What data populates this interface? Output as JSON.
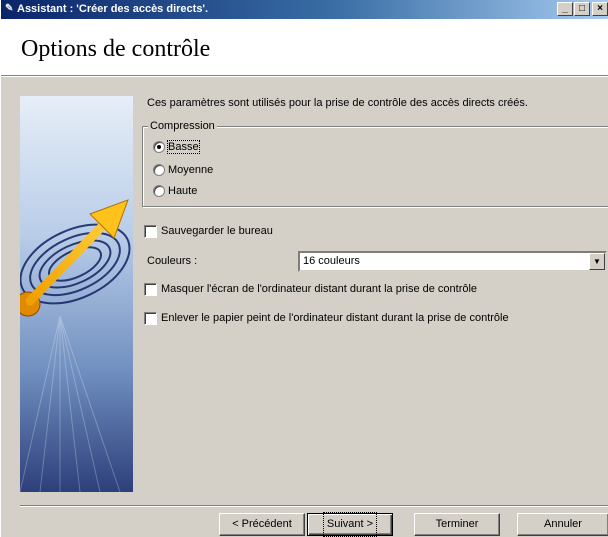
{
  "window": {
    "title": "Assistant : 'Créer des accès directs'.",
    "controls": {
      "minimize": "_",
      "maximize": "□",
      "close": "×"
    }
  },
  "header": {
    "title": "Options de contrôle"
  },
  "intro_text": "Ces paramètres sont utilisés pour la prise de contrôle des accès directs créés.",
  "compression": {
    "legend": "Compression",
    "options": [
      {
        "label": "Basse",
        "checked": true
      },
      {
        "label": "Moyenne",
        "checked": false
      },
      {
        "label": "Haute",
        "checked": false
      }
    ]
  },
  "save_desktop": {
    "label": "Sauvegarder le bureau",
    "checked": false
  },
  "colors": {
    "label": "Couleurs :",
    "value": "16 couleurs"
  },
  "hide_screen": {
    "label": "Masquer l'écran de l'ordinateur distant durant la prise de contrôle",
    "checked": false
  },
  "remove_wallpaper": {
    "label": "Enlever le papier peint de l'ordinateur distant durant la prise de contrôle",
    "checked": false
  },
  "buttons": {
    "previous": "< Précédent",
    "next": "Suivant >",
    "finish": "Terminer",
    "cancel": "Annuler"
  }
}
